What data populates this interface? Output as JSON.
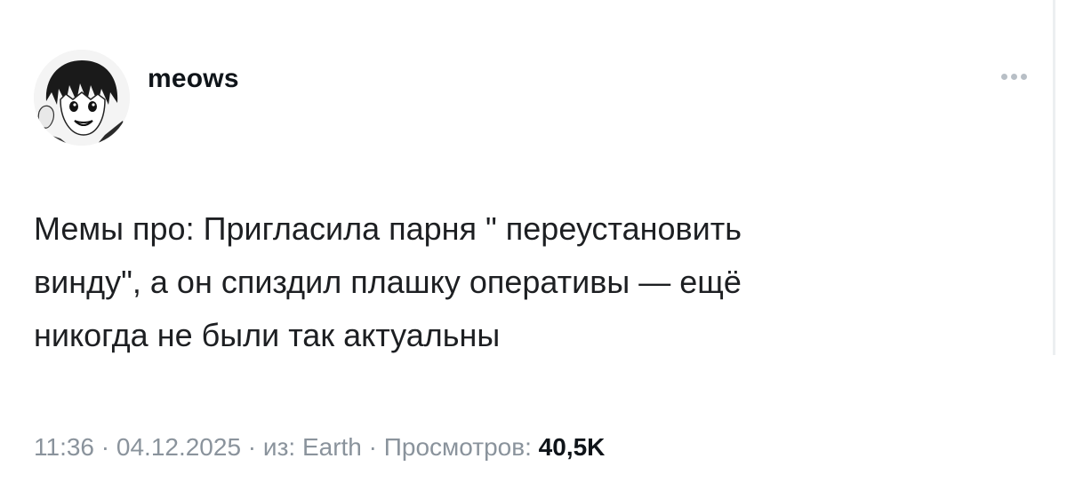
{
  "post": {
    "author": {
      "username": "meows",
      "avatar_icon": "anime-avatar-icon"
    },
    "more_icon": "more-horizontal-icon",
    "text": "Мемы про: Пригласила парня \" переустановить\nвинду\", а он спиздил плашку оперативы — ещё\nникогда не были так актуальны",
    "meta": {
      "time": "11:36",
      "separator": " · ",
      "date": "04.12.2025",
      "source": "из: Earth",
      "views_label": "Просмотров: ",
      "views_count": "40,5K"
    }
  }
}
